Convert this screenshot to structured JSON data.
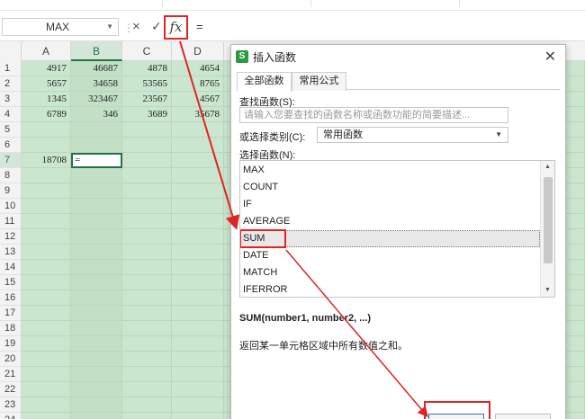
{
  "formula_bar": {
    "name_box": "MAX",
    "cancel_glyph": "×",
    "enter_glyph": "✓",
    "fx_label": "fx",
    "formula": "="
  },
  "sheet": {
    "columns": [
      "A",
      "B",
      "C",
      "D"
    ],
    "active_column": "B",
    "row_numbers": [
      "1",
      "2",
      "3",
      "4",
      "5",
      "6",
      "7",
      "8",
      "9",
      "10",
      "11",
      "12",
      "13",
      "14",
      "15",
      "16",
      "17",
      "18",
      "19",
      "20",
      "21",
      "22",
      "23",
      "24"
    ],
    "rows": [
      [
        "4917",
        "46687",
        "4878",
        "4654"
      ],
      [
        "5657",
        "34658",
        "53565",
        "8765"
      ],
      [
        "1345",
        "323467",
        "23567",
        "4567"
      ],
      [
        "6789",
        "346",
        "3689",
        "35678"
      ],
      [
        "",
        "",
        "",
        ""
      ],
      [
        "",
        "",
        "",
        ""
      ],
      [
        "18708",
        "=",
        "",
        ""
      ]
    ],
    "active_row": "7"
  },
  "dialog": {
    "title": "插入函数",
    "logo_letter": "S",
    "close_glyph": "✕",
    "tabs": [
      {
        "label": "全部函数",
        "active": true
      },
      {
        "label": "常用公式",
        "active": false
      }
    ],
    "search_label": "查找函数(S):",
    "search_placeholder": "请输入您要查找的函数名称或函数功能的简要描述...",
    "category_label": "或选择类别(C):",
    "category_value": "常用函数",
    "function_list_label": "选择函数(N):",
    "functions": [
      "MAX",
      "COUNT",
      "IF",
      "AVERAGE",
      "SUM",
      "DATE",
      "MATCH",
      "IFERROR"
    ],
    "selected_function": "SUM",
    "syntax": "SUM(number1, number2, ...)",
    "description": "返回某一单元格区域中所有数值之和。"
  },
  "colors": {
    "grid_green": "#cbe6cf",
    "annotation_red": "#e02424",
    "accent_green": "#217346"
  }
}
